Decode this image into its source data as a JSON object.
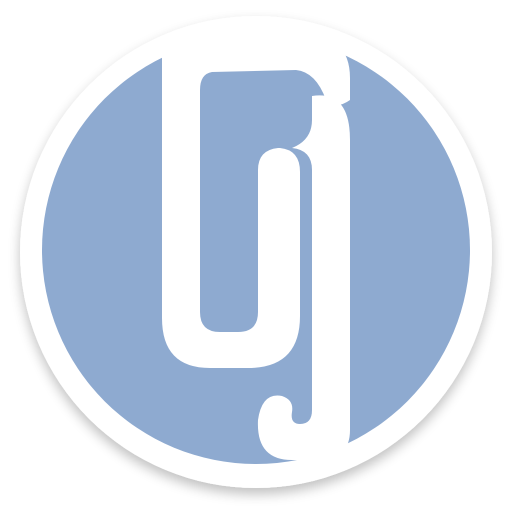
{
  "app_icon": {
    "name": "app-logo",
    "colors": {
      "background": "#ffffff",
      "badge_fill": "#8eaad0",
      "badge_ring": "#ffffff",
      "glyph": "#ffffff",
      "shadow": "#000000"
    }
  }
}
